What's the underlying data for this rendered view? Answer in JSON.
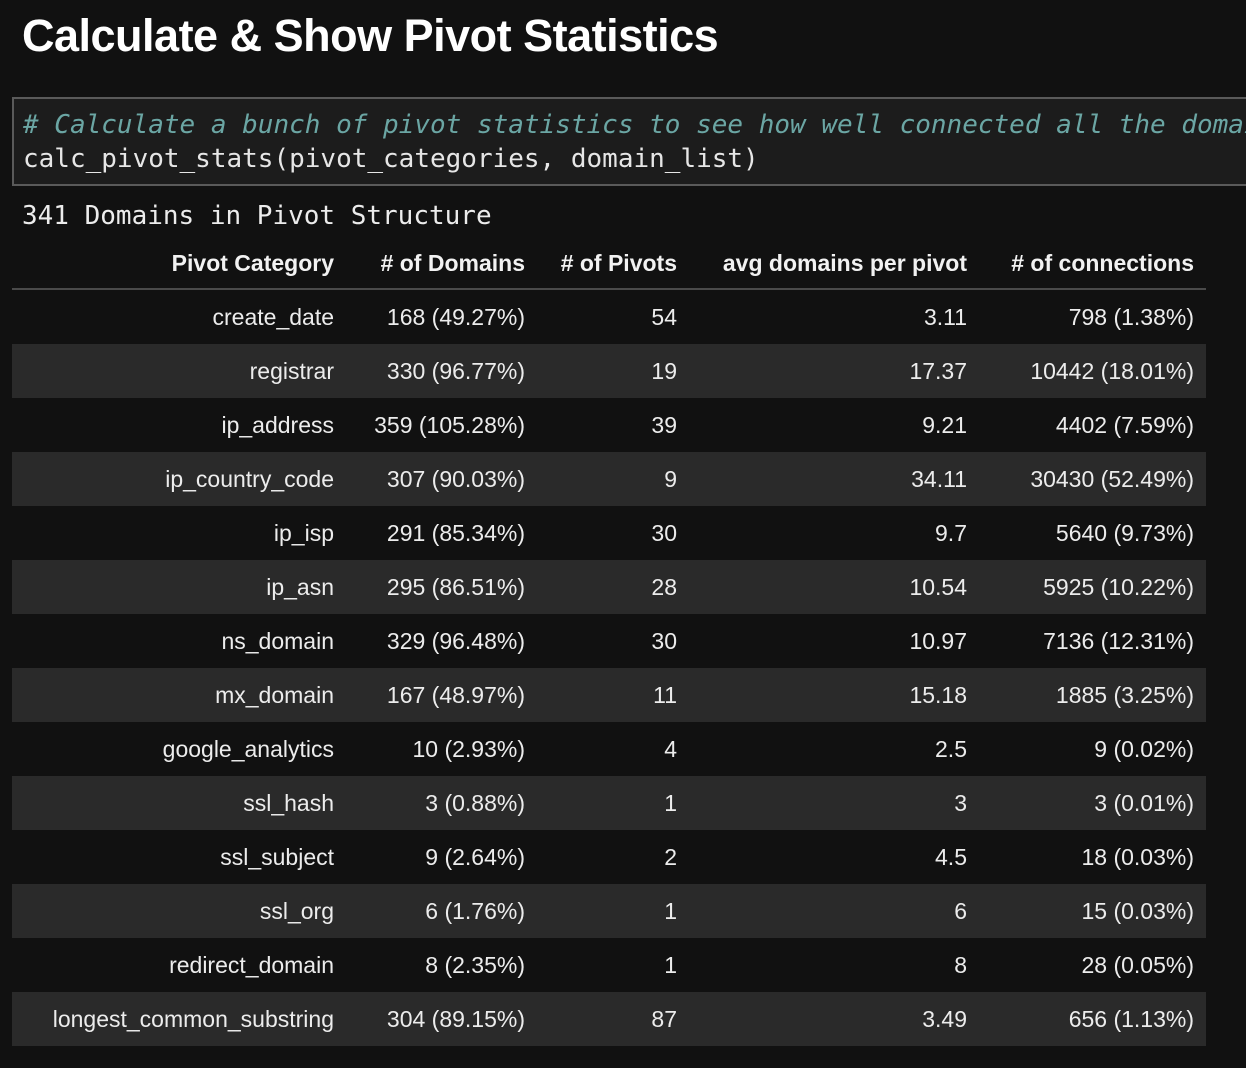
{
  "heading": "Calculate & Show Pivot Statistics",
  "code": {
    "comment": "# Calculate a bunch of pivot statistics to see how well connected all the domains are",
    "call": "calc_pivot_stats(pivot_categories, domain_list)"
  },
  "output": {
    "title": "341 Domains in Pivot Structure",
    "columns": [
      "Pivot Category",
      "# of Domains",
      "# of Pivots",
      "avg domains per pivot",
      "# of connections"
    ],
    "rows": [
      [
        "create_date",
        "168 (49.27%)",
        "54",
        "3.11",
        "798 (1.38%)"
      ],
      [
        "registrar",
        "330 (96.77%)",
        "19",
        "17.37",
        "10442 (18.01%)"
      ],
      [
        "ip_address",
        "359 (105.28%)",
        "39",
        "9.21",
        "4402 (7.59%)"
      ],
      [
        "ip_country_code",
        "307 (90.03%)",
        "9",
        "34.11",
        "30430 (52.49%)"
      ],
      [
        "ip_isp",
        "291 (85.34%)",
        "30",
        "9.7",
        "5640 (9.73%)"
      ],
      [
        "ip_asn",
        "295 (86.51%)",
        "28",
        "10.54",
        "5925 (10.22%)"
      ],
      [
        "ns_domain",
        "329 (96.48%)",
        "30",
        "10.97",
        "7136 (12.31%)"
      ],
      [
        "mx_domain",
        "167 (48.97%)",
        "11",
        "15.18",
        "1885 (3.25%)"
      ],
      [
        "google_analytics",
        "10 (2.93%)",
        "4",
        "2.5",
        "9 (0.02%)"
      ],
      [
        "ssl_hash",
        "3 (0.88%)",
        "1",
        "3",
        "3 (0.01%)"
      ],
      [
        "ssl_subject",
        "9 (2.64%)",
        "2",
        "4.5",
        "18 (0.03%)"
      ],
      [
        "ssl_org",
        "6 (1.76%)",
        "1",
        "6",
        "15 (0.03%)"
      ],
      [
        "redirect_domain",
        "8 (2.35%)",
        "1",
        "8",
        "28 (0.05%)"
      ],
      [
        "longest_common_substring",
        "304 (89.15%)",
        "87",
        "3.49",
        "656 (1.13%)"
      ]
    ]
  },
  "colors": {
    "background": "#111111",
    "stripe": "#2a2a2a",
    "comment": "#6ba6a4",
    "code_cell_border": "#5a5a5a"
  }
}
